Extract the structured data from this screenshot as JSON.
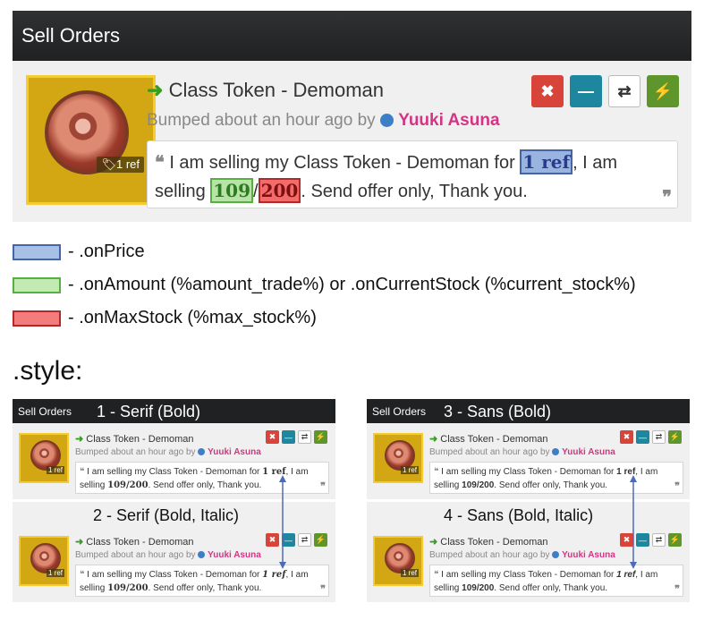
{
  "panel": {
    "title": "Sell Orders",
    "item_name": "Class Token - Demoman",
    "ref_tag": "1 ref",
    "bumped_text": "Bumped about an hour ago by",
    "user": "Yuuki Asuna",
    "quote": {
      "open_mark": "❝",
      "pre_price": " I am selling my Class Token - Demoman for ",
      "price": "1 ref",
      "mid": ", I am selling ",
      "amount": "109",
      "slash": "/",
      "max": "200",
      "post": ". Send offer only, Thank you.",
      "close_mark": "❞"
    },
    "buttons": [
      "✖",
      "—",
      "⇄",
      "⚡"
    ],
    "button_colors": [
      "#d9443a",
      "#1d87a0",
      "#ffffff",
      "#5e962b"
    ]
  },
  "legend": [
    {
      "label": "- .onPrice",
      "fill": "#a8bfe6",
      "border": "#4466a8"
    },
    {
      "label": "- .onAmount (%amount_trade%) or .onCurrentStock (%current_stock%)",
      "fill": "#c4eab3",
      "border": "#55b040"
    },
    {
      "label": "- .onMaxStock (%max_stock%)",
      "fill": "#f47c7c",
      "border": "#b42828"
    }
  ],
  "style_title": ".style:",
  "styles": [
    {
      "caption": "1 - Serif (Bold)"
    },
    {
      "caption": "2 - Serif (Bold, Italic)"
    },
    {
      "caption": "3 - Sans (Bold)"
    },
    {
      "caption": "4 - Sans (Bold, Italic)"
    }
  ],
  "mini": {
    "title": "Sell Orders",
    "item_name": "Class Token - Demoman",
    "ref_tag": "1 ref",
    "bumped_text": "Bumped about an hour ago by",
    "user": "Yuuki Asuna",
    "pre_price": " I am selling my Class Token - Demoman for ",
    "price": "1 ref",
    "mid": ", I am selling ",
    "stock": "109/200",
    "post": ". Send offer only, Thank you.",
    "open_mark": "❝",
    "close_mark": "❞"
  }
}
